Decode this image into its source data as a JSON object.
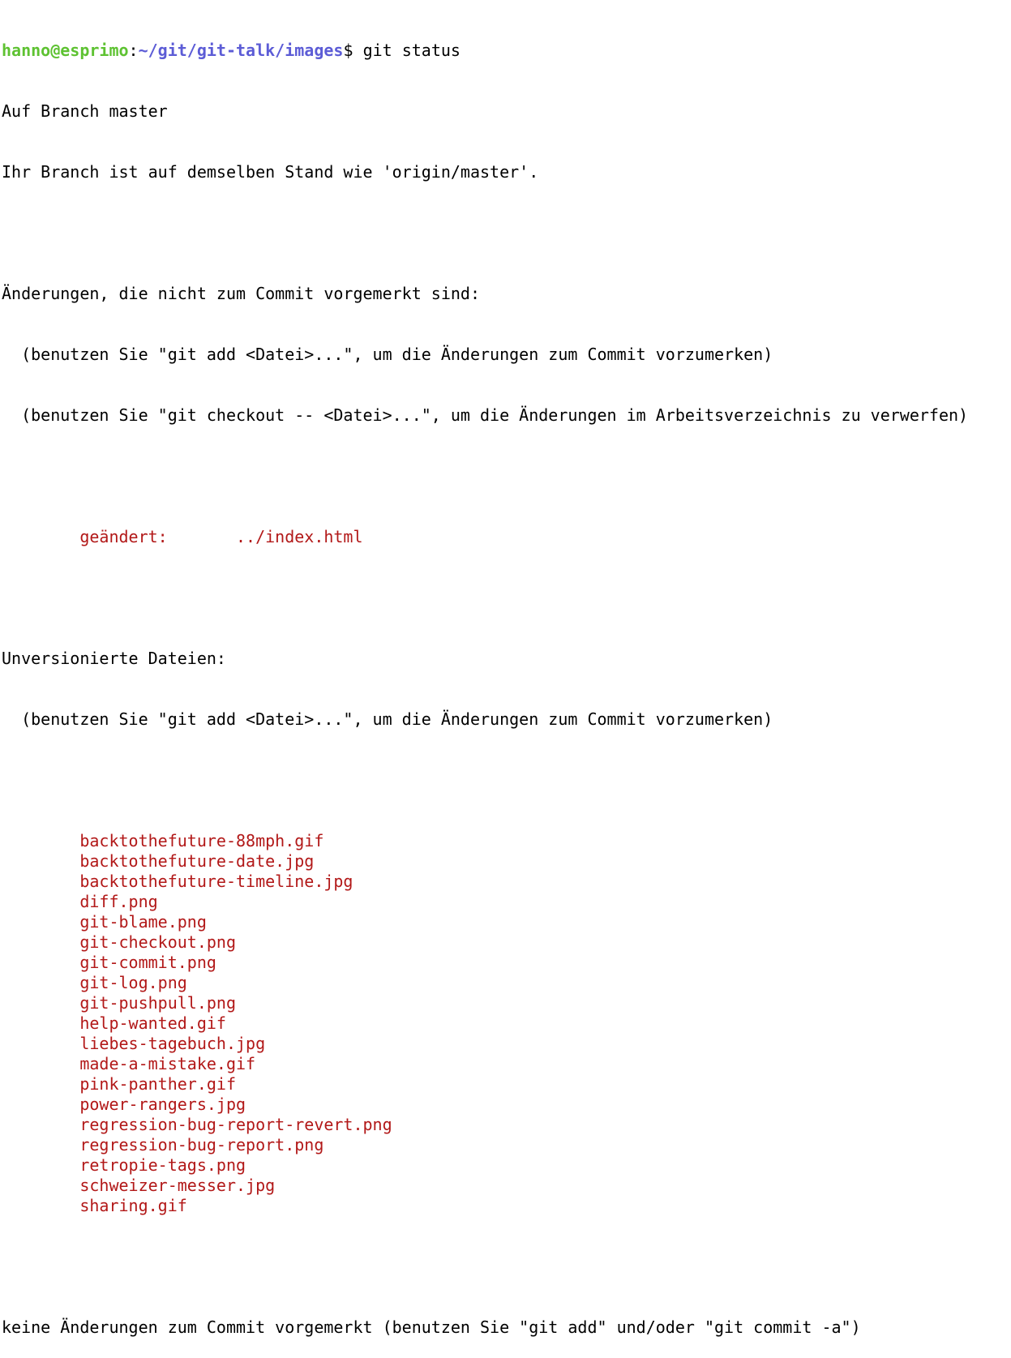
{
  "prompt": {
    "user_host": "hanno@esprimo",
    "separator": ":",
    "path": "~/git/git-talk/images",
    "symbol": "$ ",
    "command": "git status"
  },
  "branch_line": "Auf Branch master",
  "tracking_line": "Ihr Branch ist auf demselben Stand wie 'origin/master'.",
  "not_staged": {
    "header": "Änderungen, die nicht zum Commit vorgemerkt sind:",
    "hint1": "  (benutzen Sie \"git add <Datei>...\", um die Änderungen zum Commit vorzumerken)",
    "hint2": "  (benutzen Sie \"git checkout -- <Datei>...\", um die Änderungen im Arbeitsverzeichnis zu verwerfen)",
    "entry": "        geändert:       ../index.html"
  },
  "untracked": {
    "header": "Unversionierte Dateien:",
    "hint": "  (benutzen Sie \"git add <Datei>...\", um die Änderungen zum Commit vorzumerken)",
    "files": [
      "backtothefuture-88mph.gif",
      "backtothefuture-date.jpg",
      "backtothefuture-timeline.jpg",
      "diff.png",
      "git-blame.png",
      "git-checkout.png",
      "git-commit.png",
      "git-log.png",
      "git-pushpull.png",
      "help-wanted.gif",
      "liebes-tagebuch.jpg",
      "made-a-mistake.gif",
      "pink-panther.gif",
      "power-rangers.jpg",
      "regression-bug-report-revert.png",
      "regression-bug-report.png",
      "retropie-tags.png",
      "schweizer-messer.jpg",
      "sharing.gif"
    ]
  },
  "footer": "keine Änderungen zum Commit vorgemerkt (benutzen Sie \"git add\" und/oder \"git commit -a\")",
  "colors": {
    "prompt_user": "#5ec232",
    "prompt_path": "#5c5cd6",
    "modified": "#b21818",
    "text": "#000000",
    "background": "#ffffff"
  }
}
